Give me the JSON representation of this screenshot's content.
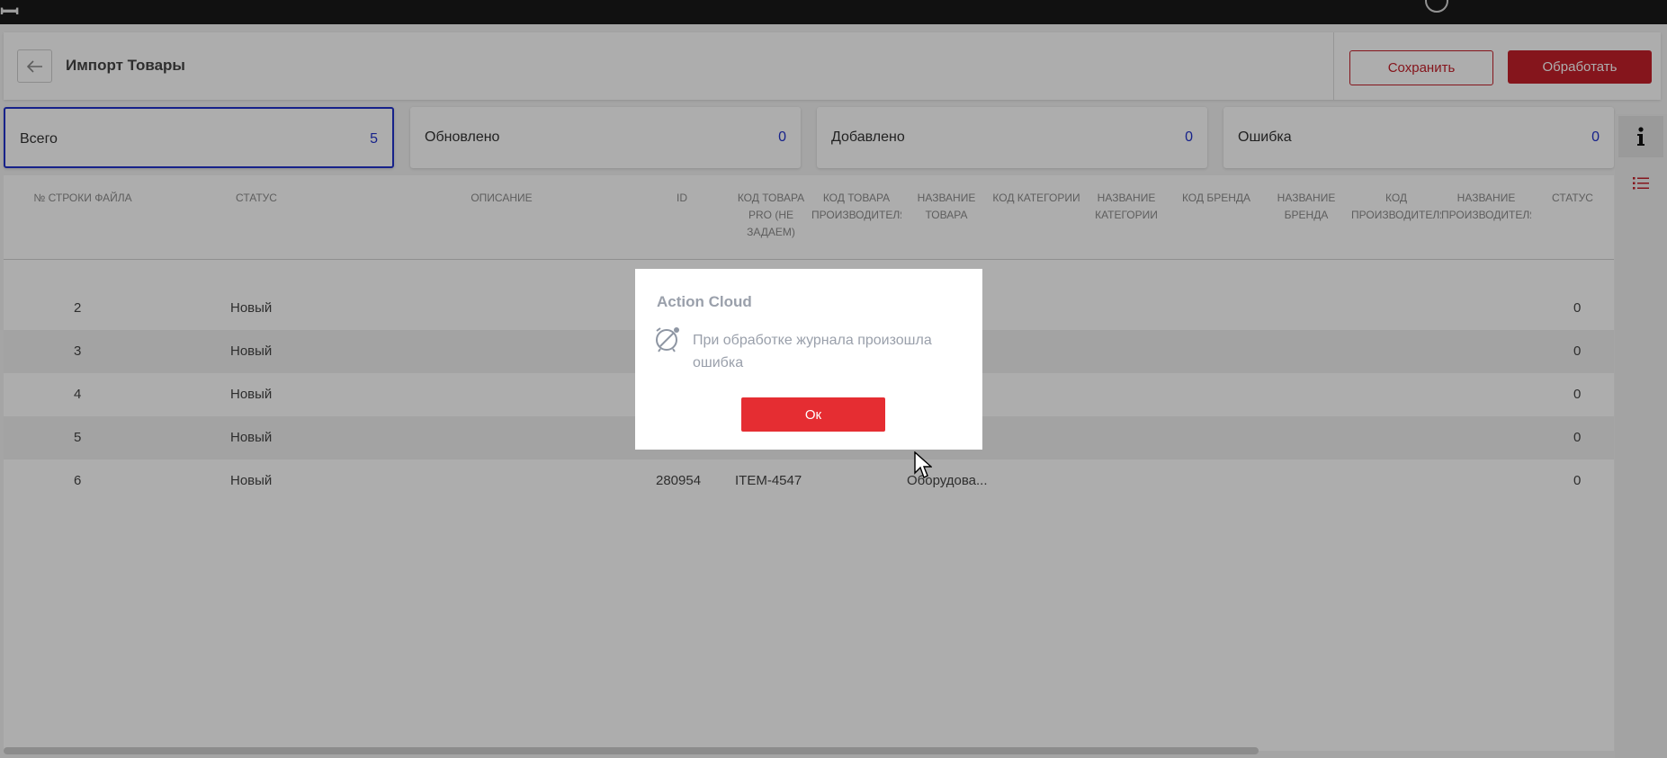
{
  "header": {
    "title": "Импорт Товары",
    "save_label": "Сохранить",
    "process_label": "Обработать"
  },
  "stats": [
    {
      "label": "Всего",
      "count": "5",
      "active": true
    },
    {
      "label": "Обновлено",
      "count": "0",
      "active": false
    },
    {
      "label": "Добавлено",
      "count": "0",
      "active": false
    },
    {
      "label": "Ошибка",
      "count": "0",
      "active": false
    }
  ],
  "table": {
    "columns": [
      "№ строки файла",
      "Статус",
      "Описание",
      "ID",
      "Код товара PRO (не задаем)",
      "Код товара производителя",
      "Название товара",
      "Код категории",
      "Название категории",
      "Код бренда",
      "Название бренда",
      "Код производителя",
      "Название производителя",
      "Статус"
    ],
    "rows": [
      {
        "line": "2",
        "status": "Новый",
        "id": "",
        "code": "",
        "name": "",
        "status2": "0"
      },
      {
        "line": "3",
        "status": "Новый",
        "id": "",
        "code": "",
        "name": "",
        "status2": "0"
      },
      {
        "line": "4",
        "status": "Новый",
        "id": "",
        "code": "",
        "name": "",
        "status2": "0"
      },
      {
        "line": "5",
        "status": "Новый",
        "id": "",
        "code": "",
        "name": "",
        "status2": "0"
      },
      {
        "line": "6",
        "status": "Новый",
        "id": "280954",
        "code": "ITEM-4547",
        "name": "Оборудова...",
        "status2": "0"
      }
    ]
  },
  "dialog": {
    "title": "Action Cloud",
    "message": "При обработке журнала произошла ошибка",
    "ok_label": "Ок",
    "icon": "error-clock-icon"
  },
  "icons": {
    "back": "arrow-left-icon",
    "info": "info-icon",
    "list": "list-icon"
  },
  "colors": {
    "accent_red": "#c4202a",
    "ok_red": "#e52d32",
    "active_blue": "#2233cc"
  }
}
